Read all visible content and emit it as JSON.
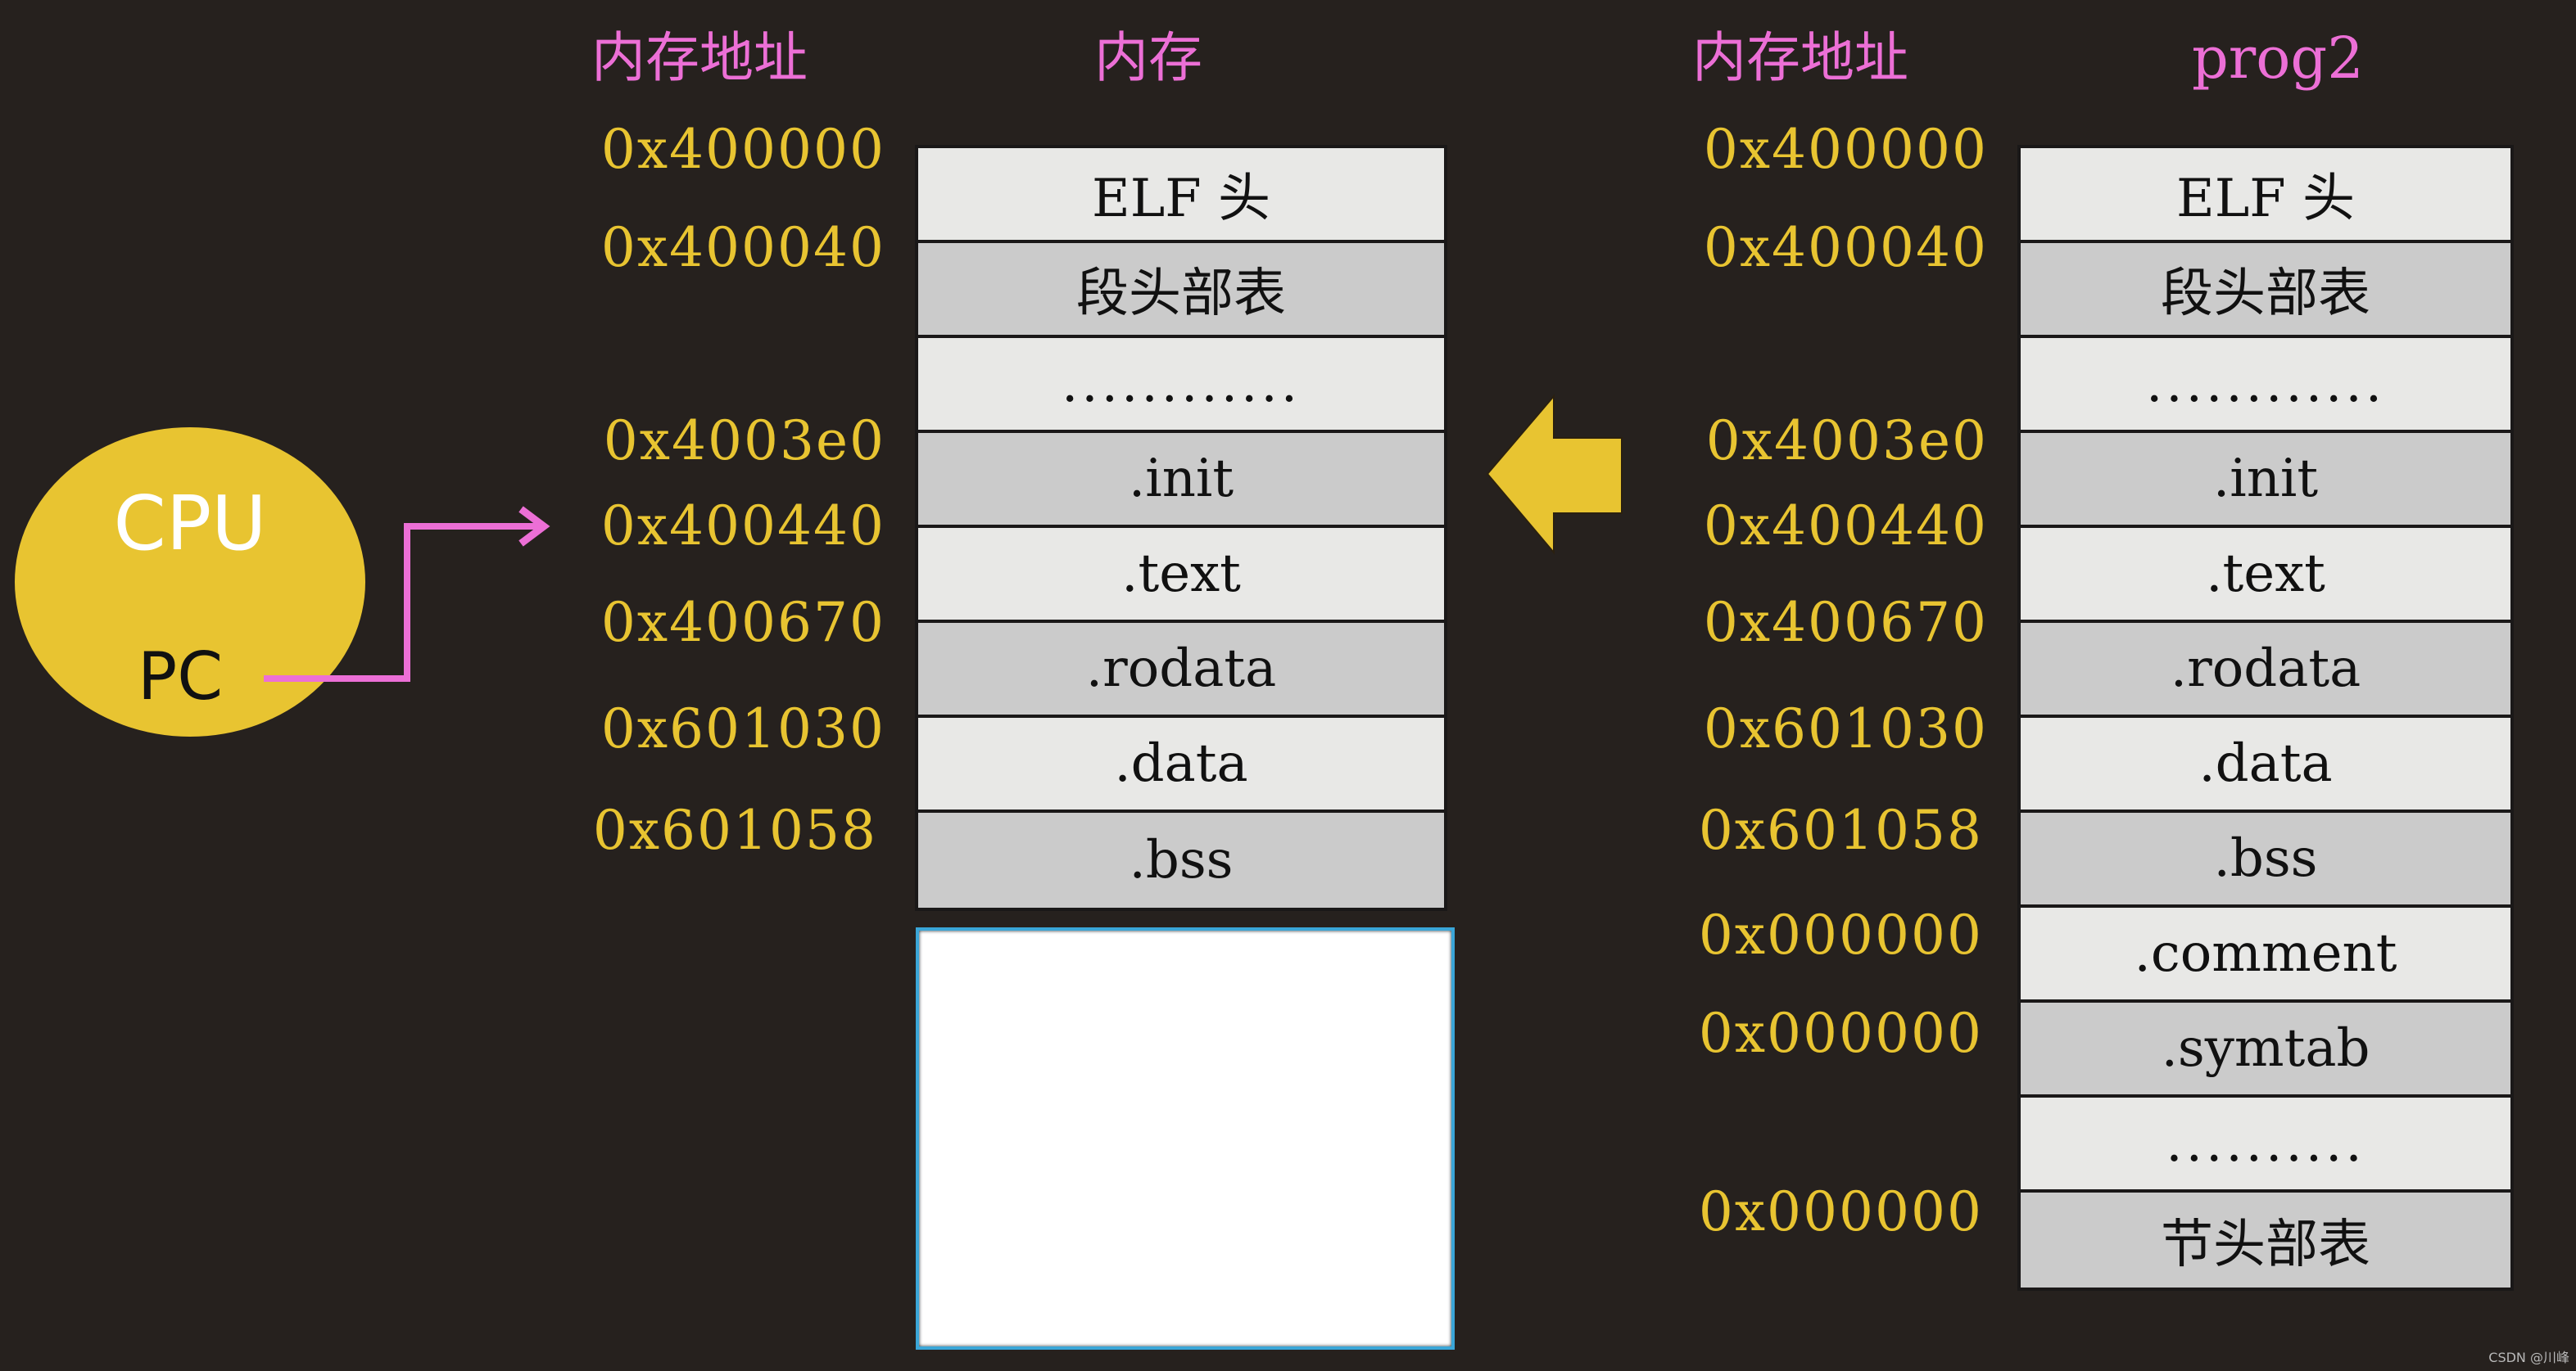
{
  "headers": {
    "left_address": "内存地址",
    "left_memory": "内存",
    "right_address": "内存地址",
    "right_program": "prog2"
  },
  "cpu": {
    "label": "CPU",
    "register": "PC",
    "points_to": "0x400440"
  },
  "memory": {
    "addresses": [
      "0x400000",
      "0x400040",
      "0x4003e0",
      "0x400440",
      "0x400670",
      "0x601030",
      "0x601058"
    ],
    "cells": [
      {
        "label": "ELF 头",
        "shade": "light"
      },
      {
        "label": "段头部表",
        "shade": "dark"
      },
      {
        "label": "............",
        "shade": "light"
      },
      {
        "label": ".init",
        "shade": "dark"
      },
      {
        "label": ".text",
        "shade": "light"
      },
      {
        "label": ".rodata",
        "shade": "dark"
      },
      {
        "label": ".data",
        "shade": "light"
      },
      {
        "label": ".bss",
        "shade": "dark"
      }
    ]
  },
  "program": {
    "addresses": [
      "0x400000",
      "0x400040",
      "0x4003e0",
      "0x400440",
      "0x400670",
      "0x601030",
      "0x601058",
      "0x000000",
      "0x000000",
      "0x000000"
    ],
    "cells": [
      {
        "label": "ELF 头",
        "shade": "light"
      },
      {
        "label": "段头部表",
        "shade": "dark"
      },
      {
        "label": "............",
        "shade": "light"
      },
      {
        "label": ".init",
        "shade": "dark"
      },
      {
        "label": ".text",
        "shade": "light"
      },
      {
        "label": ".rodata",
        "shade": "dark"
      },
      {
        "label": ".data",
        "shade": "light"
      },
      {
        "label": ".bss",
        "shade": "dark"
      },
      {
        "label": ".comment",
        "shade": "light"
      },
      {
        "label": ".symtab",
        "shade": "dark"
      },
      {
        "label": "..........",
        "shade": "light"
      },
      {
        "label": "节头部表",
        "shade": "dark"
      }
    ]
  },
  "load_arrow": {
    "direction": "left",
    "meaning": "load prog2 into memory"
  },
  "colors": {
    "background": "#26211e",
    "header": "#ec6fd6",
    "address": "#e8c431",
    "cpu": "#e8c431",
    "pc_arrow": "#ec6fd6",
    "load_arrow": "#e8c431"
  },
  "watermark": "CSDN @川峰"
}
